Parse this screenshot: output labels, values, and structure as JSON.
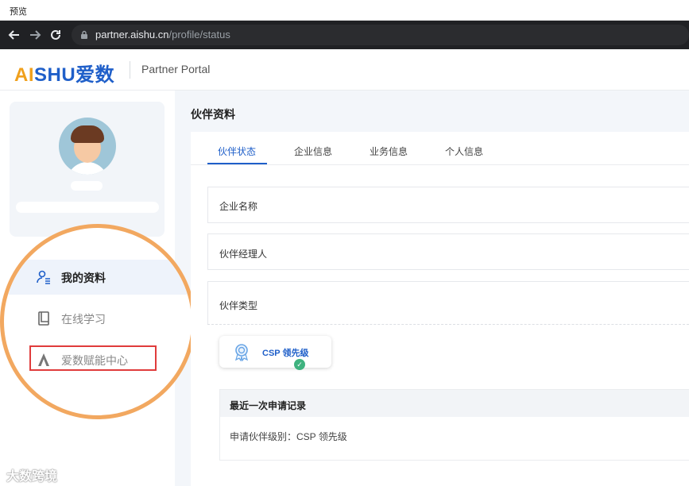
{
  "window": {
    "title": "预览"
  },
  "browser": {
    "back_icon": "arrow-left-icon",
    "forward_icon": "arrow-right-icon",
    "reload_icon": "reload-icon",
    "url_host": "partner.aishu.cn",
    "url_path": "/profile/status"
  },
  "header": {
    "logo_ai": "AI",
    "logo_shu": "SHU爱数",
    "portal_name": "Partner Portal"
  },
  "sidebar": {
    "menu": [
      {
        "label": "我的资料",
        "icon": "user-profile-icon",
        "active": true
      },
      {
        "label": "在线学习",
        "icon": "book-icon",
        "active": false
      },
      {
        "label": "爱数赋能中心",
        "icon": "aishu-logo-icon",
        "active": false
      }
    ]
  },
  "main": {
    "title": "伙伴资料",
    "tabs": [
      "伙伴状态",
      "企业信息",
      "业务信息",
      "个人信息"
    ],
    "active_tab": 0,
    "fields": {
      "company_name_label": "企业名称",
      "manager_label": "伙伴经理人",
      "partner_type_label": "伙伴类型"
    },
    "partner_badge": "CSP 领先级",
    "record": {
      "title": "最近一次申请记录",
      "line": "申请伙伴级别：CSP 领先级"
    }
  },
  "watermark": "大数跨境",
  "colors": {
    "accent": "#1f5fc9",
    "logo_orange": "#f0a01c",
    "highlight_circle": "#f2a860",
    "highlight_box": "#e03c3c",
    "success": "#3fb27f"
  }
}
